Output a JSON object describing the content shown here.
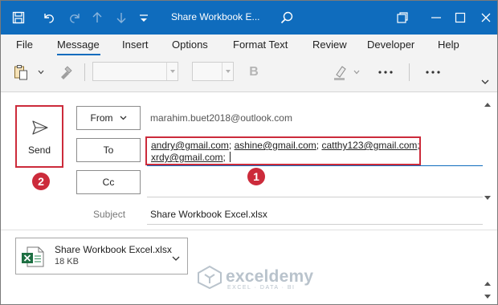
{
  "window": {
    "title": "Share Workbook E...",
    "accent_color": "#0f6cbd",
    "highlight_color": "#cc2b3b"
  },
  "titlebar": {
    "icons": [
      "save-icon",
      "undo-icon",
      "redo-icon",
      "up-arrow-icon",
      "down-arrow-icon",
      "customize-icon",
      "search-icon",
      "restore-icon",
      "minimize-icon",
      "maximize-icon",
      "close-icon"
    ]
  },
  "menu": {
    "tabs": [
      "File",
      "Message",
      "Insert",
      "Options",
      "Format Text",
      "Review",
      "Developer",
      "Help"
    ],
    "active_tab": "Message"
  },
  "ribbon": {
    "font_name": "",
    "font_size": "",
    "bold_label": "B",
    "icons": [
      "paste-icon",
      "format-painter-icon",
      "bold-icon",
      "highlight-icon",
      "more-icon",
      "more-icon",
      "collapse-icon"
    ]
  },
  "compose": {
    "send_label": "Send",
    "from_label": "From",
    "from_address": "marahim.buet2018@outlook.com",
    "to_label": "To",
    "cc_label": "Cc",
    "subject_label": "Subject",
    "subject_value": "Share Workbook Excel.xlsx",
    "recipients": [
      "andry@gmail.com",
      "ashine@gmail.com",
      "catthy123@gmail.com",
      "xrdy@gmail.com"
    ],
    "markers": {
      "recipients": "1",
      "send": "2"
    }
  },
  "attachment": {
    "file_name": "Share Workbook Excel.xlsx",
    "file_size": "18 KB",
    "icon": "excel-file-icon"
  },
  "watermark": {
    "name": "exceldemy",
    "tagline": "EXCEL · DATA · BI"
  }
}
